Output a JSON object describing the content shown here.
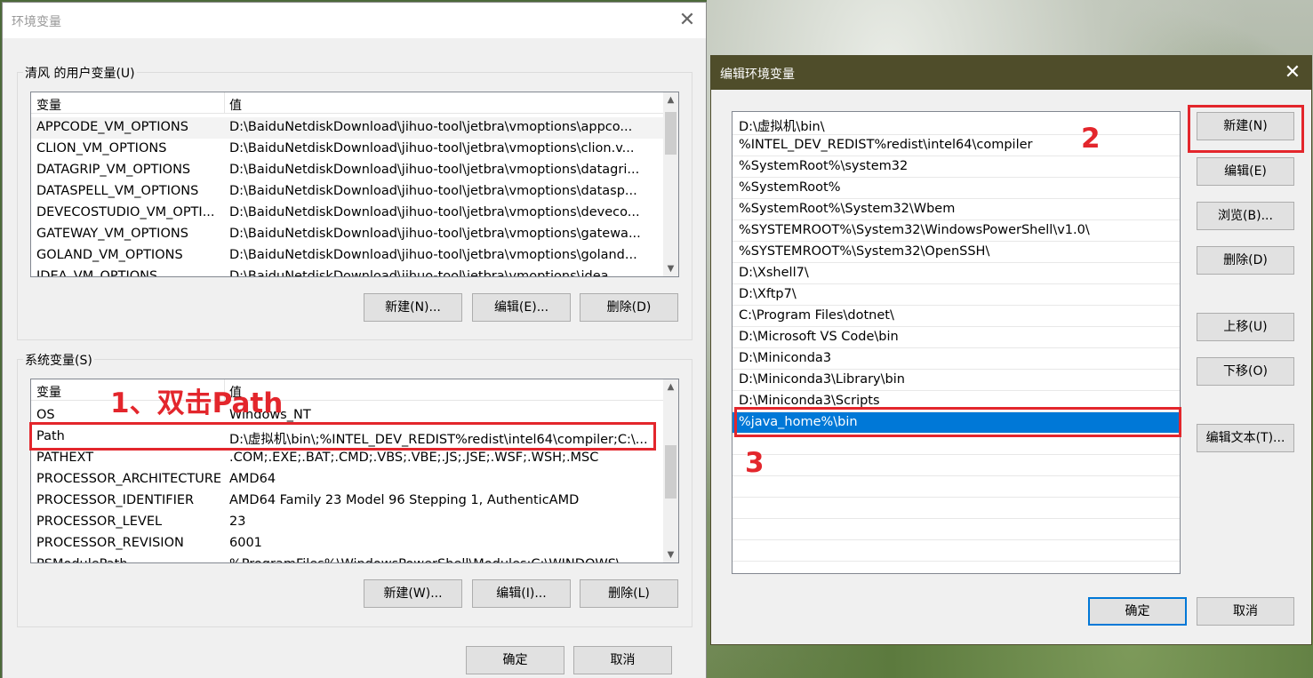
{
  "env_dialog": {
    "title": "环境变量",
    "user_group_label": "清风 的用户变量(U)",
    "system_group_label": "系统变量(S)",
    "col_var": "变量",
    "col_val": "值",
    "user_vars": [
      {
        "name": "APPCODE_VM_OPTIONS",
        "value": "D:\\BaiduNetdiskDownload\\jihuo-tool\\jetbra\\vmoptions\\appco..."
      },
      {
        "name": "CLION_VM_OPTIONS",
        "value": "D:\\BaiduNetdiskDownload\\jihuo-tool\\jetbra\\vmoptions\\clion.v..."
      },
      {
        "name": "DATAGRIP_VM_OPTIONS",
        "value": "D:\\BaiduNetdiskDownload\\jihuo-tool\\jetbra\\vmoptions\\datagri..."
      },
      {
        "name": "DATASPELL_VM_OPTIONS",
        "value": "D:\\BaiduNetdiskDownload\\jihuo-tool\\jetbra\\vmoptions\\datasp..."
      },
      {
        "name": "DEVECOSTUDIO_VM_OPTI...",
        "value": "D:\\BaiduNetdiskDownload\\jihuo-tool\\jetbra\\vmoptions\\deveco..."
      },
      {
        "name": "GATEWAY_VM_OPTIONS",
        "value": "D:\\BaiduNetdiskDownload\\jihuo-tool\\jetbra\\vmoptions\\gatewa..."
      },
      {
        "name": "GOLAND_VM_OPTIONS",
        "value": "D:\\BaiduNetdiskDownload\\jihuo-tool\\jetbra\\vmoptions\\goland..."
      },
      {
        "name": "IDEA_VM_OPTIONS",
        "value": "D:\\BaiduNetdiskDownload\\jihuo-tool\\jetbra\\vmoptions\\idea..."
      }
    ],
    "user_buttons": {
      "new": "新建(N)...",
      "edit": "编辑(E)...",
      "delete": "删除(D)"
    },
    "system_vars": [
      {
        "name": "OS",
        "value": "Windows_NT"
      },
      {
        "name": "Path",
        "value": "D:\\虚拟机\\bin\\;%INTEL_DEV_REDIST%redist\\intel64\\compiler;C:\\..."
      },
      {
        "name": "PATHEXT",
        "value": ".COM;.EXE;.BAT;.CMD;.VBS;.VBE;.JS;.JSE;.WSF;.WSH;.MSC"
      },
      {
        "name": "PROCESSOR_ARCHITECTURE",
        "value": "AMD64"
      },
      {
        "name": "PROCESSOR_IDENTIFIER",
        "value": "AMD64 Family 23 Model 96 Stepping 1, AuthenticAMD"
      },
      {
        "name": "PROCESSOR_LEVEL",
        "value": "23"
      },
      {
        "name": "PROCESSOR_REVISION",
        "value": "6001"
      },
      {
        "name": "PSModulePath",
        "value": "%ProgramFiles%\\WindowsPowerShell\\Modules;C:\\WINDOWS\\..."
      }
    ],
    "system_buttons": {
      "new": "新建(W)...",
      "edit": "编辑(I)...",
      "delete": "删除(L)"
    },
    "ok": "确定",
    "cancel": "取消"
  },
  "edit_dialog": {
    "title": "编辑环境变量",
    "paths": [
      "D:\\虚拟机\\bin\\",
      "%INTEL_DEV_REDIST%redist\\intel64\\compiler",
      "%SystemRoot%\\system32",
      "%SystemRoot%",
      "%SystemRoot%\\System32\\Wbem",
      "%SYSTEMROOT%\\System32\\WindowsPowerShell\\v1.0\\",
      "%SYSTEMROOT%\\System32\\OpenSSH\\",
      "D:\\Xshell7\\",
      "D:\\Xftp7\\",
      "C:\\Program Files\\dotnet\\",
      "D:\\Microsoft VS Code\\bin",
      "D:\\Miniconda3",
      "D:\\Miniconda3\\Library\\bin",
      "D:\\Miniconda3\\Scripts",
      "%java_home%\\bin"
    ],
    "selected_index": 14,
    "buttons": {
      "new": "新建(N)",
      "edit": "编辑(E)",
      "browse": "浏览(B)...",
      "delete": "删除(D)",
      "move_up": "上移(U)",
      "move_down": "下移(O)",
      "edit_text": "编辑文本(T)..."
    },
    "ok": "确定",
    "cancel": "取消"
  },
  "annotations": {
    "step1": "1、双击Path",
    "step2": "2",
    "step3": "3"
  },
  "colors": {
    "annotation_red": "#e3262c",
    "selection_blue": "#0078d7",
    "edit_titlebar": "#4f4d2a"
  }
}
